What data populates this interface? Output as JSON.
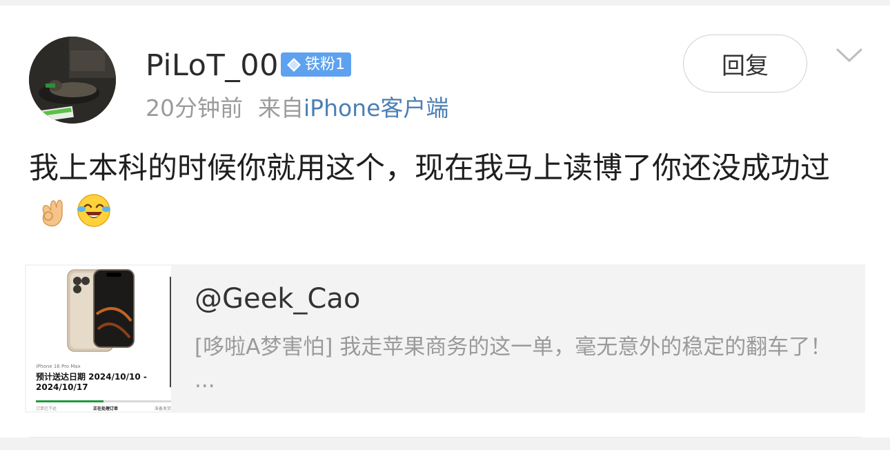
{
  "comment": {
    "author": {
      "username": "PiLoT_00",
      "fan_badge": "铁粉1"
    },
    "time": "20分钟前",
    "source_prefix": "来自",
    "source_link": "iPhone客户端",
    "reply_label": "回复",
    "body_text": "我上本科的时候你就用这个，现在我马上读博了你还没成功过",
    "emojis": [
      "ok-hand-emoji",
      "laughing-crying-emoji"
    ]
  },
  "quote": {
    "author": "@Geek_Cao",
    "text": "[哆啦A梦害怕] 我走苹果商务的这一单，毫无意外的稳定的翻车了！ ...",
    "thumbnail": {
      "model": "iPhone 16 Pro Max",
      "delivery": "预计送达日期 2024/10/10 - 2024/10/17",
      "progress": 0.5,
      "steps": [
        "订单已下达",
        "正在处理订单",
        "准备发货"
      ],
      "active_step_index": 1
    }
  },
  "colors": {
    "badge": "#5ea2ef",
    "link": "#4a7fb5",
    "meta": "#9b9b9b",
    "quote_bg": "#f3f3f3",
    "progress": "#1a9b38"
  }
}
